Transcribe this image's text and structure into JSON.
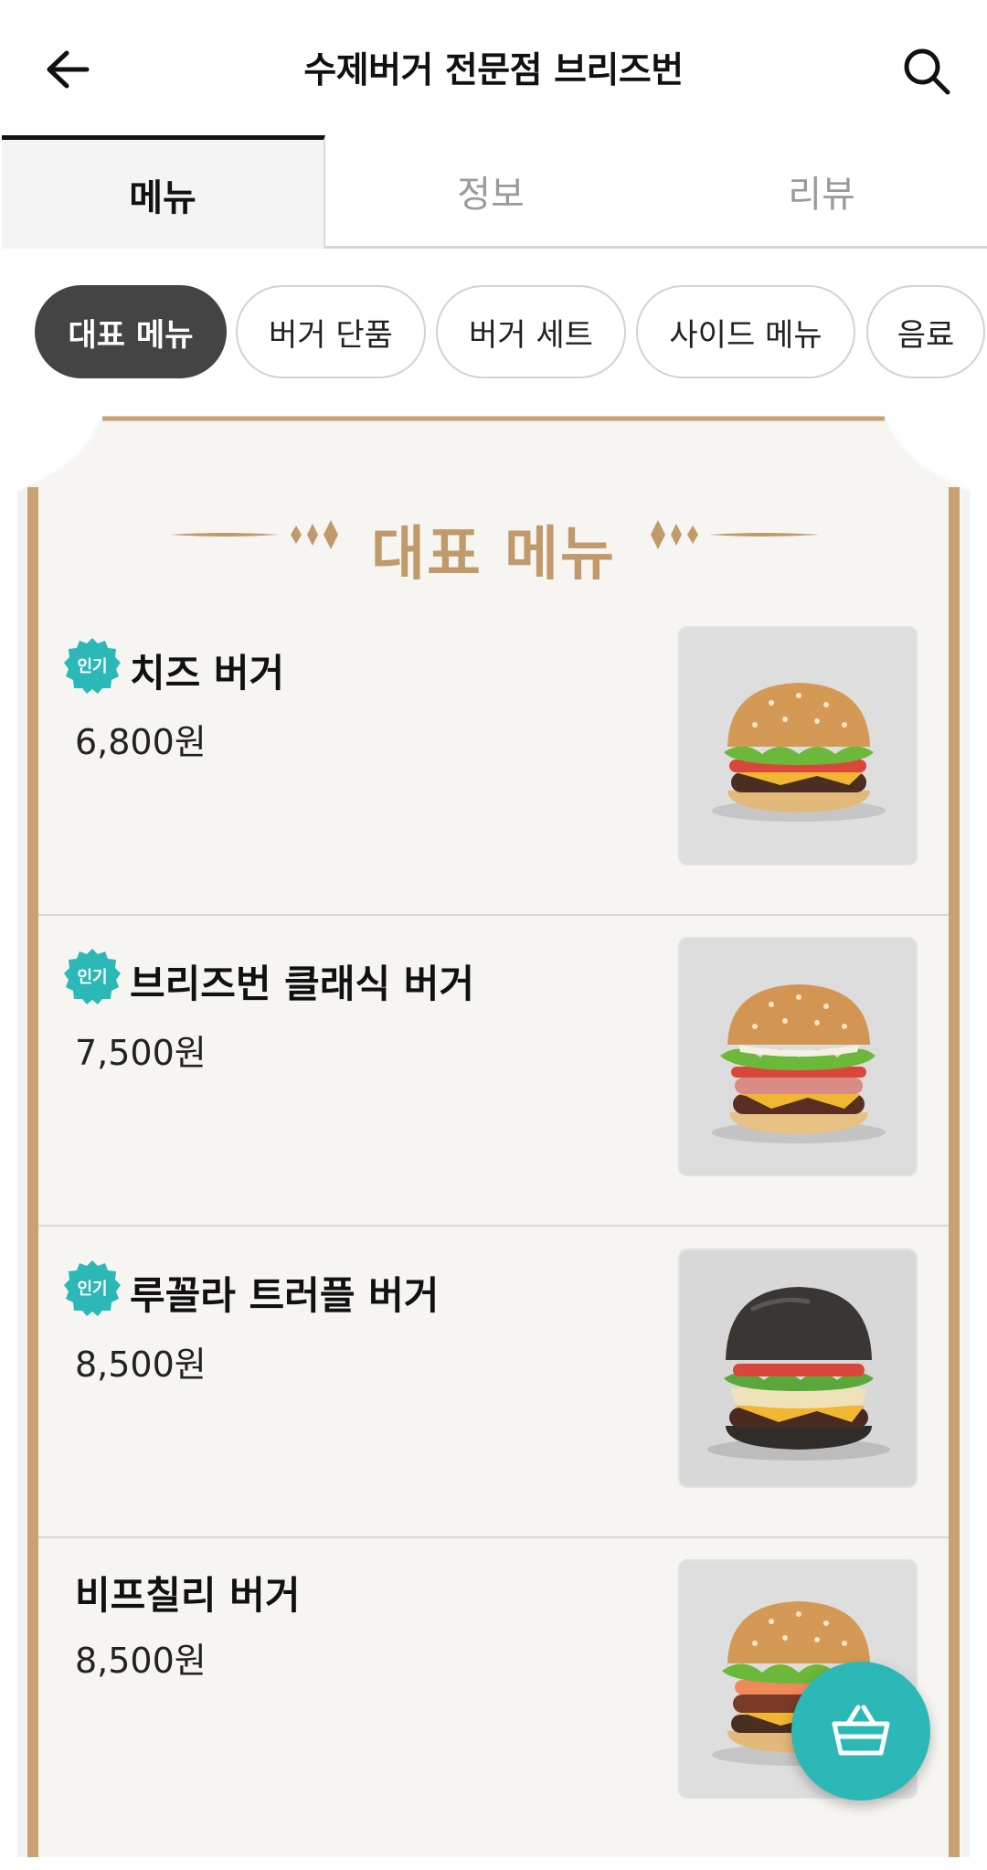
{
  "header": {
    "title": "수제버거 전문점 브리즈번",
    "back_icon": "arrow-left-icon",
    "search_icon": "search-icon"
  },
  "tabs": [
    {
      "label": "메뉴",
      "selected": true
    },
    {
      "label": "정보",
      "selected": false
    },
    {
      "label": "리뷰",
      "selected": false
    }
  ],
  "categories": [
    {
      "label": "대표 메뉴",
      "selected": true
    },
    {
      "label": "버거 단품",
      "selected": false
    },
    {
      "label": "버거 세트",
      "selected": false
    },
    {
      "label": "사이드 메뉴",
      "selected": false
    },
    {
      "label": "음료",
      "selected": false
    }
  ],
  "section": {
    "title": "대표 메뉴",
    "accent_color": "#c09a6a"
  },
  "menu_items": [
    {
      "name": "치즈 버거",
      "price": "6,800원",
      "badge": "인기",
      "bun": "sesame"
    },
    {
      "name": "브리즈번 클래식 버거",
      "price": "7,500원",
      "badge": "인기",
      "bun": "sesame"
    },
    {
      "name": "루꼴라 트러플 버거",
      "price": "8,500원",
      "badge": "인기",
      "bun": "black"
    },
    {
      "name": "비프칠리 버거",
      "price": "8,500원",
      "badge": "",
      "bun": "sesame"
    }
  ],
  "badge_color": "#2bb8b6",
  "cart_button": {
    "icon": "basket-icon",
    "color": "#2bb8b6"
  }
}
